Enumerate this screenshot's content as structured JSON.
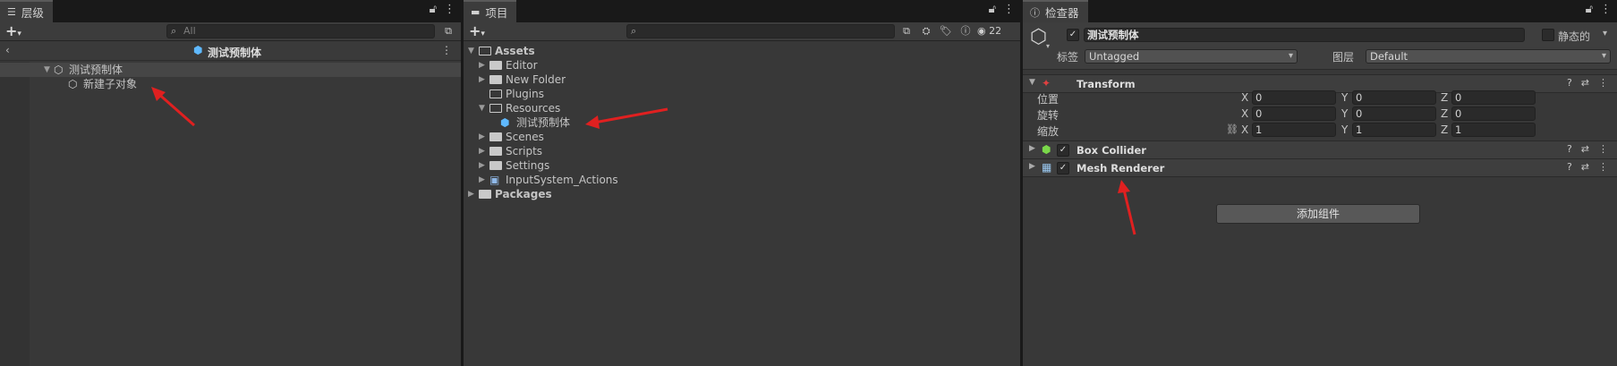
{
  "hierarchy": {
    "tab_label": "层级",
    "search_placeholder": "All",
    "prefab_title": "测试预制体",
    "root_item": "测试预制体",
    "child_item": "新建子对象"
  },
  "project": {
    "tab_label": "项目",
    "search_placeholder": "",
    "visible_count": "22",
    "tree": [
      {
        "label": "Assets",
        "type": "folder-open",
        "indent": 0,
        "expanded": true,
        "bold": true
      },
      {
        "label": "Editor",
        "type": "folder",
        "indent": 1,
        "expanded": false
      },
      {
        "label": "New Folder",
        "type": "folder",
        "indent": 1,
        "expanded": false
      },
      {
        "label": "Plugins",
        "type": "folder-empty",
        "indent": 1,
        "expanded": null
      },
      {
        "label": "Resources",
        "type": "folder-open",
        "indent": 1,
        "expanded": true
      },
      {
        "label": "测试预制体",
        "type": "prefab",
        "indent": 2,
        "expanded": null
      },
      {
        "label": "Scenes",
        "type": "folder",
        "indent": 1,
        "expanded": false
      },
      {
        "label": "Scripts",
        "type": "folder",
        "indent": 1,
        "expanded": false
      },
      {
        "label": "Settings",
        "type": "folder",
        "indent": 1,
        "expanded": false
      },
      {
        "label": "InputSystem_Actions",
        "type": "asset",
        "indent": 1,
        "expanded": false
      },
      {
        "label": "Packages",
        "type": "folder",
        "indent": 0,
        "expanded": false,
        "bold": true
      }
    ]
  },
  "inspector": {
    "tab_label": "检查器",
    "object_name": "测试预制体",
    "static_label": "静态的",
    "tag_label": "标签",
    "tag_value": "Untagged",
    "layer_label": "图层",
    "layer_value": "Default",
    "transform": {
      "title": "Transform",
      "position_label": "位置",
      "rotation_label": "旋转",
      "scale_label": "缩放",
      "position": {
        "x": "0",
        "y": "0",
        "z": "0"
      },
      "rotation": {
        "x": "0",
        "y": "0",
        "z": "0"
      },
      "scale": {
        "x": "1",
        "y": "1",
        "z": "1"
      }
    },
    "components": [
      {
        "title": "Box Collider",
        "enabled": true
      },
      {
        "title": "Mesh Renderer",
        "enabled": true
      }
    ],
    "add_component_label": "添加组件",
    "axis_x": "X",
    "axis_y": "Y",
    "axis_z": "Z"
  },
  "colors": {
    "annotation_arrow": "#e02020",
    "prefab_blue": "#5fb9ff",
    "panel_bg": "#383838"
  }
}
